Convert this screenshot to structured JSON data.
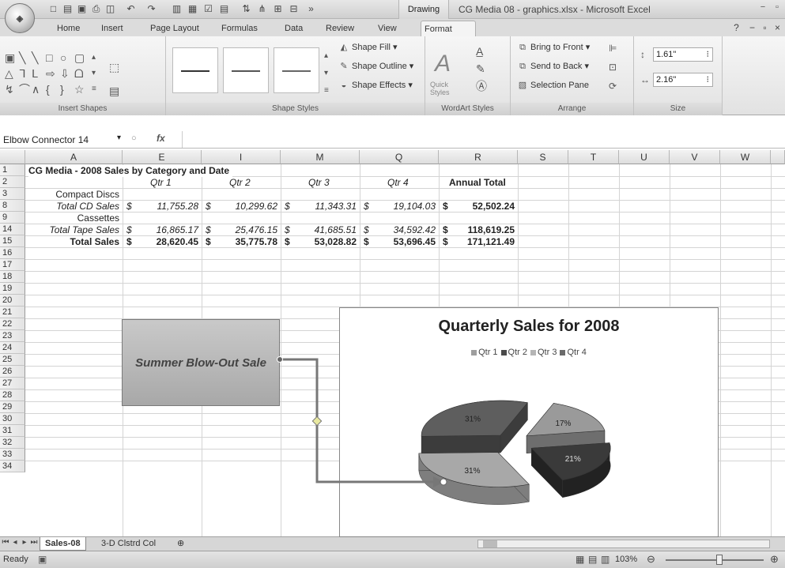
{
  "window": {
    "title": "CG Media 08 - graphics.xlsx - Microsoft Excel",
    "contextual_tab": "Drawing Tools",
    "office_logo": "office-button"
  },
  "tabs": [
    "Home",
    "Insert",
    "Page Layout",
    "Formulas",
    "Data",
    "Review",
    "View",
    "Format"
  ],
  "active_tab": "Format",
  "ribbon": {
    "groups": {
      "insert_shapes": "Insert Shapes",
      "shape_styles": "Shape Styles",
      "wordart_styles": "WordArt Styles",
      "arrange": "Arrange",
      "size": "Size"
    },
    "shape_fill": "Shape Fill",
    "shape_outline": "Shape Outline",
    "shape_effects": "Shape Effects",
    "quick_styles": "Quick Styles",
    "bring_to_front": "Bring to Front",
    "send_to_back": "Send to Back",
    "selection_pane": "Selection Pane",
    "height": "1.61\"",
    "width": "2.16\""
  },
  "formula_bar": {
    "name_box": "Elbow Connector 14",
    "fx": "fx",
    "value": ""
  },
  "columns": [
    "A",
    "E",
    "I",
    "M",
    "Q",
    "R",
    "S",
    "T",
    "U",
    "V",
    "W"
  ],
  "rows": [
    "1",
    "2",
    "3",
    "8",
    "9",
    "14",
    "15",
    "16",
    "17",
    "18",
    "19",
    "20",
    "21",
    "22",
    "23",
    "24",
    "25",
    "26",
    "27",
    "28",
    "29",
    "30",
    "31",
    "32",
    "33",
    "34"
  ],
  "cells": {
    "title": "CG Media - 2008 Sales by Category and Date",
    "q1": "Qtr 1",
    "q2": "Qtr 2",
    "q3": "Qtr 3",
    "q4": "Qtr 4",
    "annual": "Annual Total",
    "compact_discs": "Compact Discs",
    "total_cd": "Total CD Sales",
    "cassettes": "Cassettes",
    "total_tape": "Total Tape Sales",
    "total_sales": "Total Sales",
    "cd_values": [
      "11,755.28",
      "10,299.62",
      "11,343.31",
      "19,104.03",
      "52,502.24"
    ],
    "tape_values": [
      "16,865.17",
      "25,476.15",
      "41,685.51",
      "34,592.42",
      "118,619.25"
    ],
    "total_values": [
      "28,620.45",
      "35,775.78",
      "53,028.82",
      "53,696.45",
      "171,121.49"
    ],
    "dollar": "$"
  },
  "textbox": "Summer Blow-Out Sale",
  "chart_data": {
    "type": "pie",
    "title": "Quarterly Sales for 2008",
    "categories": [
      "Qtr 1",
      "Qtr 2",
      "Qtr 3",
      "Qtr 4"
    ],
    "values": [
      17,
      21,
      31,
      31
    ],
    "labels": [
      "17%",
      "21%",
      "31%",
      "31%"
    ],
    "colors": [
      "#9e9e9e",
      "#4a4a4a",
      "#b5b5b5",
      "#6a6a6a"
    ],
    "legend": "top"
  },
  "sheets": [
    "Sales-08",
    "3-D Clstrd Col"
  ],
  "active_sheet": "Sales-08",
  "status": {
    "mode": "Ready",
    "zoom": "103%",
    "zoom_level": 0.55
  }
}
